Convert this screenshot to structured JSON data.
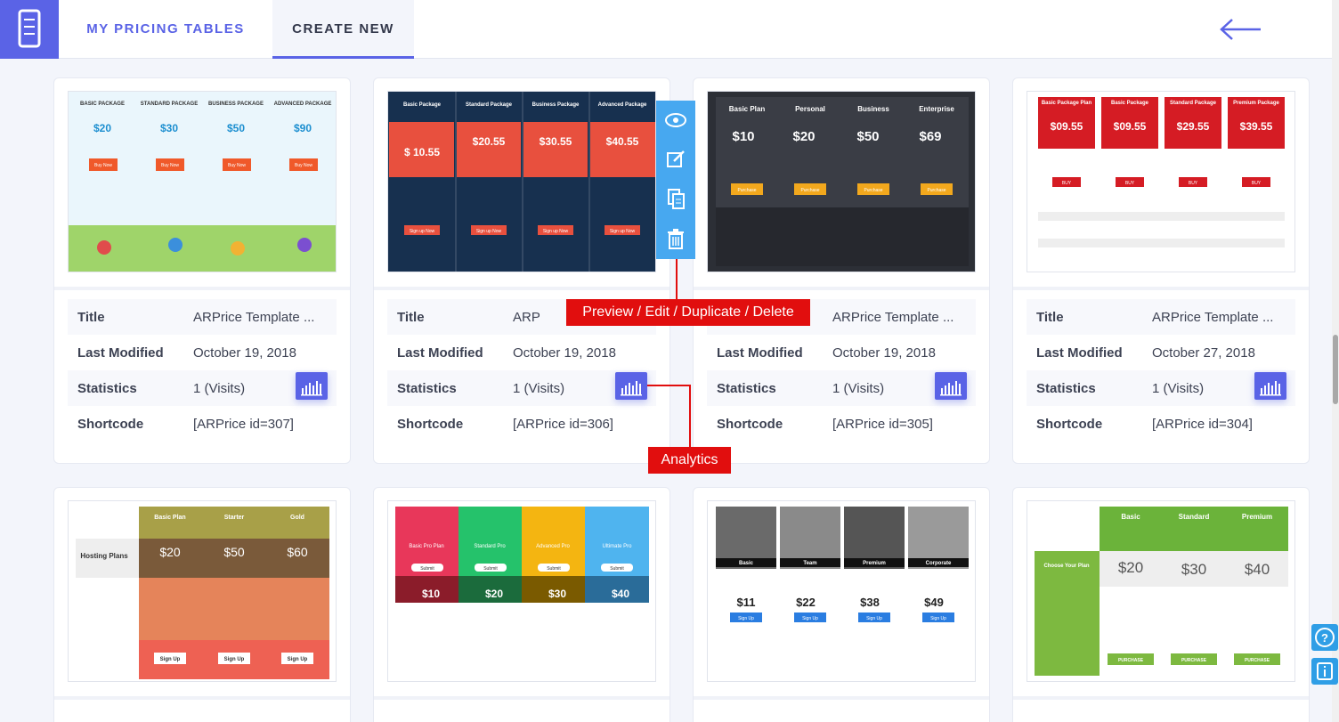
{
  "header": {
    "tab_my": "MY PRICING TABLES",
    "tab_create": "CREATE NEW"
  },
  "labels": {
    "title": "Title",
    "modified": "Last Modified",
    "statistics": "Statistics",
    "shortcode": "Shortcode"
  },
  "cards": [
    {
      "title": "ARPrice Template ...",
      "modified": "October 19, 2018",
      "visits": "1 (Visits)",
      "shortcode": "[ARPrice id=307]"
    },
    {
      "title": "ARP",
      "modified": "October 19, 2018",
      "visits": "1 (Visits)",
      "shortcode": "[ARPrice id=306]"
    },
    {
      "title": "ARPrice Template ...",
      "modified": "October 19, 2018",
      "visits": "1 (Visits)",
      "shortcode": "[ARPrice id=305]"
    },
    {
      "title": "ARPrice Template ...",
      "modified": "October 27, 2018",
      "visits": "1 (Visits)",
      "shortcode": "[ARPrice id=304]"
    }
  ],
  "callouts": {
    "actions": "Preview / Edit / Duplicate / Delete",
    "analytics": "Analytics"
  },
  "thumb1": {
    "cols": [
      {
        "name": "BASIC PACKAGE",
        "price": "$20"
      },
      {
        "name": "STANDARD PACKAGE",
        "price": "$30"
      },
      {
        "name": "BUSINESS PACKAGE",
        "price": "$50"
      },
      {
        "name": "ADVANCED PACKAGE",
        "price": "$90"
      }
    ],
    "button": "Buy Now"
  },
  "thumb2": {
    "cols": [
      {
        "name": "Basic Package",
        "price": "$ 10.55"
      },
      {
        "name": "Standard Package",
        "price": "$20.55"
      },
      {
        "name": "Business Package",
        "price": "$30.55"
      },
      {
        "name": "Advanced Package",
        "price": "$40.55"
      }
    ],
    "button": "Sign up Now"
  },
  "thumb3": {
    "cols": [
      {
        "name": "Basic Plan",
        "price": "$10"
      },
      {
        "name": "Personal",
        "price": "$20"
      },
      {
        "name": "Business",
        "price": "$50"
      },
      {
        "name": "Enterprise",
        "price": "$69"
      }
    ],
    "button": "Purchase"
  },
  "thumb4": {
    "cols": [
      {
        "name": "Basic Package Plan",
        "price": "$09.55"
      },
      {
        "name": "Basic Package",
        "price": "$09.55"
      },
      {
        "name": "Standard Package",
        "price": "$29.55"
      },
      {
        "name": "Premium Package",
        "price": "$39.55"
      }
    ],
    "button": "BUY"
  },
  "thumb5": {
    "label": "Hosting Plans",
    "cols": [
      {
        "name": "Basic Plan",
        "price": "$20"
      },
      {
        "name": "Starter",
        "price": "$50"
      },
      {
        "name": "Gold",
        "price": "$60"
      }
    ],
    "button": "Sign Up"
  },
  "thumb6": {
    "cols": [
      {
        "name": "Basic Pro Plan",
        "price": "$10"
      },
      {
        "name": "Standard Pro",
        "price": "$20"
      },
      {
        "name": "Advanced Pro",
        "price": "$30"
      },
      {
        "name": "Ultimate Pro",
        "price": "$40"
      }
    ],
    "button": "Submit"
  },
  "thumb7": {
    "cols": [
      {
        "name": "Basic",
        "price": "$11"
      },
      {
        "name": "Team",
        "price": "$22"
      },
      {
        "name": "Premium",
        "price": "$38"
      },
      {
        "name": "Corporate",
        "price": "$49"
      }
    ],
    "button": "Sign Up"
  },
  "thumb8": {
    "label": "Choose Your Plan",
    "cols": [
      {
        "name": "Basic",
        "price": "$20"
      },
      {
        "name": "Standard",
        "price": "$30"
      },
      {
        "name": "Premium",
        "price": "$40"
      }
    ],
    "button": "PURCHASE"
  }
}
